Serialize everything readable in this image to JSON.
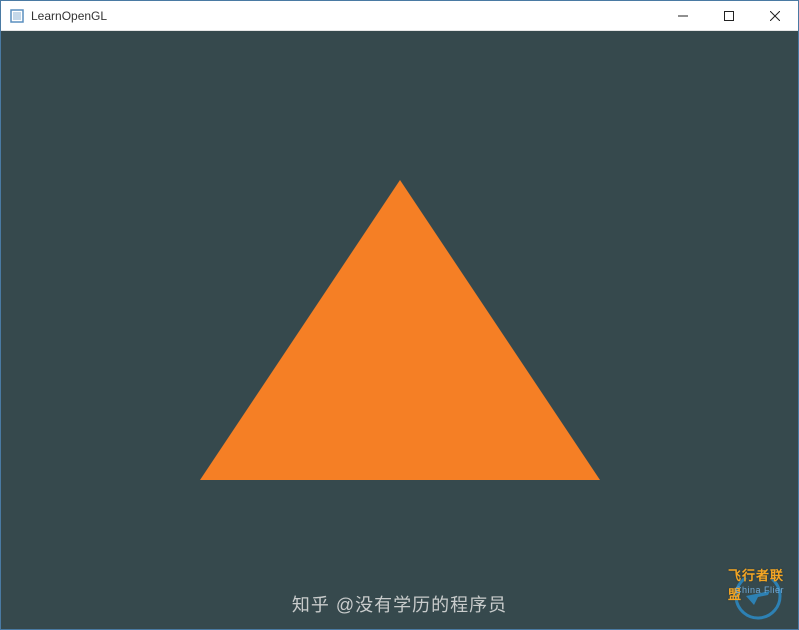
{
  "window": {
    "title": "LearnOpenGL",
    "icon_name": "app-icon"
  },
  "controls": {
    "minimize_label": "Minimize",
    "maximize_label": "Maximize",
    "close_label": "Close"
  },
  "scene": {
    "background_color": "#36494d",
    "triangle_color": "#f57f25"
  },
  "watermark": {
    "main": "知乎 @没有学历的程序员",
    "logo_top": "飞行者联盟",
    "logo_sub": "China Flier"
  }
}
